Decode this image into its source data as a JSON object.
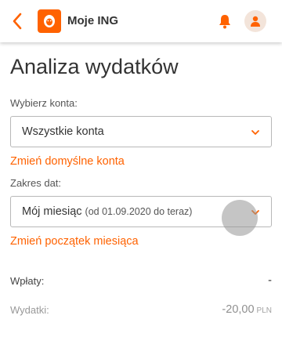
{
  "header": {
    "app_title": "Moje ING",
    "accent_color": "#ff6200",
    "icons": [
      "back-arrow-icon",
      "ing-lion-logo",
      "bell-icon",
      "user-icon"
    ]
  },
  "page": {
    "title": "Analiza wydatków"
  },
  "accounts": {
    "label": "Wybierz konta:",
    "selected": "Wszystkie konta",
    "change_link": "Zmień domyślne konta"
  },
  "date_range": {
    "label": "Zakres dat:",
    "selected": "Mój miesiąc",
    "hint": "(od 01.09.2020 do teraz)",
    "change_link": "Zmień początek miesiąca"
  },
  "summary": {
    "income_label": "Wpłaty:",
    "income_value": "-",
    "expenses_label": "Wydatki:",
    "expenses_value": "-20,00",
    "currency": "PLN"
  }
}
